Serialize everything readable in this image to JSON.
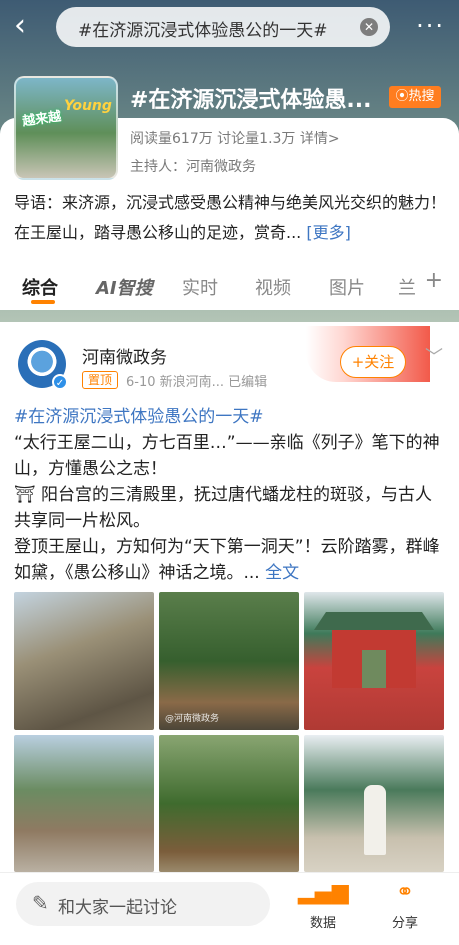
{
  "header": {
    "search_text": "#在济源沉浸式体验愚公的一天#",
    "back_glyph": "‹",
    "more_glyph": "···"
  },
  "topic": {
    "title": "#在济源沉浸式体验愚...",
    "hot_badge": "热搜",
    "stats": "阅读量617万  讨论量1.3万  详情>",
    "host": "主持人：河南微政务",
    "intro": "导语：来济源，沉浸式感受愚公精神与绝美风光交织的魅力！在王屋山，踏寻愚公移山的足迹，赏奇...",
    "intro_more": "[更多]",
    "thumb_text": "越来越",
    "thumb_young": "Young"
  },
  "tabs": [
    "综合",
    "AI智搜",
    "实时",
    "视频",
    "图片",
    "兰"
  ],
  "tabs_plus": "+",
  "post": {
    "author": "河南微政务",
    "pin_label": "置顶",
    "meta": "6-10  新浪河南...  已编辑",
    "follow_label": "+关注",
    "hashtag": "#在济源沉浸式体验愚公的一天#",
    "line1": "“太行王屋二山，方七百里…”——亲临《列子》笔下的神山，方懂愚公之志！",
    "line2": "⛩ 阳台宫的三清殿里，抚过唐代蟠龙柱的斑驳，与古人共享同一片松风。",
    "line3": "登顶王屋山，方知何为“天下第一洞天”！云阶踏雾，群峰如黛，《愚公移山》神话之境。...",
    "full_link": "全文",
    "watermark": "@河南微政务"
  },
  "bottom": {
    "comment_placeholder": "和大家一起讨论",
    "data_label": "数据",
    "share_label": "分享"
  }
}
